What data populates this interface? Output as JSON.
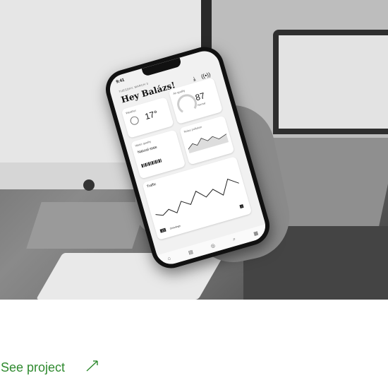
{
  "phone": {
    "status_time": "9:41",
    "date": "TUESDAY, MARCH 3",
    "greeting": "Hey Balázs!",
    "weather": {
      "title": "Weather",
      "temp": "17°"
    },
    "air_quality": {
      "title": "Air quality",
      "value": "87",
      "status": "Normal"
    },
    "water_quality": {
      "title": "Water quality",
      "status": "Natural state"
    },
    "pollution": {
      "title": "Noise pollution"
    },
    "traffic": {
      "title": "Traffic",
      "badge_number": "23",
      "badge_label": "Crossings"
    }
  },
  "link": {
    "label": "See project",
    "color": "#2f8a2f"
  }
}
